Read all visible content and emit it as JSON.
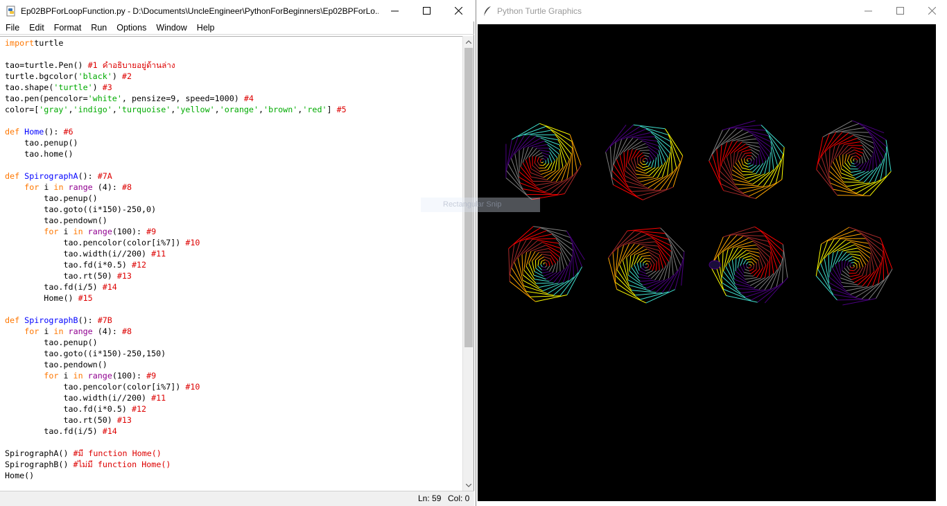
{
  "idle": {
    "title": "Ep02BPForLoopFunction.py - D:\\Documents\\UncleEngineer\\PythonForBeginners\\Ep02BPForLo...",
    "menu": [
      "File",
      "Edit",
      "Format",
      "Run",
      "Options",
      "Window",
      "Help"
    ],
    "code_lines": [
      [
        [
          "kw",
          "import"
        ],
        [
          "",
          "turtle"
        ]
      ],
      [],
      [
        [
          "",
          "tao=turtle.Pen() "
        ],
        [
          "cm",
          "#1 คำอธิบายอยู่ด้านล่าง"
        ]
      ],
      [
        [
          "",
          "turtle.bgcolor("
        ],
        [
          "str",
          "'black'"
        ],
        [
          "",
          ") "
        ],
        [
          "cm",
          "#2"
        ]
      ],
      [
        [
          "",
          "tao.shape("
        ],
        [
          "str",
          "'turtle'"
        ],
        [
          "",
          ") "
        ],
        [
          "cm",
          "#3"
        ]
      ],
      [
        [
          "",
          "tao.pen(pencolor="
        ],
        [
          "str",
          "'white'"
        ],
        [
          "",
          ", pensize=9, speed=1000) "
        ],
        [
          "cm",
          "#4"
        ]
      ],
      [
        [
          "",
          "color=["
        ],
        [
          "str",
          "'gray'"
        ],
        [
          "",
          ","
        ],
        [
          "str",
          "'indigo'"
        ],
        [
          "",
          ","
        ],
        [
          "str",
          "'turquoise'"
        ],
        [
          "",
          ","
        ],
        [
          "str",
          "'yellow'"
        ],
        [
          "",
          ","
        ],
        [
          "str",
          "'orange'"
        ],
        [
          "",
          ","
        ],
        [
          "str",
          "'brown'"
        ],
        [
          "",
          ","
        ],
        [
          "str",
          "'red'"
        ],
        [
          "",
          "] "
        ],
        [
          "cm",
          "#5"
        ]
      ],
      [],
      [
        [
          "kw",
          "def"
        ],
        [
          "",
          " "
        ],
        [
          "df",
          "Home"
        ],
        [
          "",
          "(): "
        ],
        [
          "cm",
          "#6"
        ]
      ],
      [
        [
          "",
          "    tao.penup()"
        ]
      ],
      [
        [
          "",
          "    tao.home()"
        ]
      ],
      [],
      [
        [
          "kw",
          "def"
        ],
        [
          "",
          " "
        ],
        [
          "df",
          "SpirographA"
        ],
        [
          "",
          "(): "
        ],
        [
          "cm",
          "#7A"
        ]
      ],
      [
        [
          "",
          "    "
        ],
        [
          "kw",
          "for"
        ],
        [
          "",
          " i "
        ],
        [
          "kw",
          "in"
        ],
        [
          "",
          " "
        ],
        [
          "bi",
          "range"
        ],
        [
          "",
          " (4): "
        ],
        [
          "cm",
          "#8"
        ]
      ],
      [
        [
          "",
          "        tao.penup()"
        ]
      ],
      [
        [
          "",
          "        tao.goto((i*150)-250,0)"
        ]
      ],
      [
        [
          "",
          "        tao.pendown()"
        ]
      ],
      [
        [
          "",
          "        "
        ],
        [
          "kw",
          "for"
        ],
        [
          "",
          " i "
        ],
        [
          "kw",
          "in"
        ],
        [
          "",
          " "
        ],
        [
          "bi",
          "range"
        ],
        [
          "",
          "(100): "
        ],
        [
          "cm",
          "#9"
        ]
      ],
      [
        [
          "",
          "            tao.pencolor(color[i%7]) "
        ],
        [
          "cm",
          "#10"
        ]
      ],
      [
        [
          "",
          "            tao.width(i//200) "
        ],
        [
          "cm",
          "#11"
        ]
      ],
      [
        [
          "",
          "            tao.fd(i*0.5) "
        ],
        [
          "cm",
          "#12"
        ]
      ],
      [
        [
          "",
          "            tao.rt(50) "
        ],
        [
          "cm",
          "#13"
        ]
      ],
      [
        [
          "",
          "        tao.fd(i/5) "
        ],
        [
          "cm",
          "#14"
        ]
      ],
      [
        [
          "",
          "        Home() "
        ],
        [
          "cm",
          "#15"
        ]
      ],
      [],
      [
        [
          "kw",
          "def"
        ],
        [
          "",
          " "
        ],
        [
          "df",
          "SpirographB"
        ],
        [
          "",
          "(): "
        ],
        [
          "cm",
          "#7B"
        ]
      ],
      [
        [
          "",
          "    "
        ],
        [
          "kw",
          "for"
        ],
        [
          "",
          " i "
        ],
        [
          "kw",
          "in"
        ],
        [
          "",
          " "
        ],
        [
          "bi",
          "range"
        ],
        [
          "",
          " (4): "
        ],
        [
          "cm",
          "#8"
        ]
      ],
      [
        [
          "",
          "        tao.penup()"
        ]
      ],
      [
        [
          "",
          "        tao.goto((i*150)-250,150)"
        ]
      ],
      [
        [
          "",
          "        tao.pendown()"
        ]
      ],
      [
        [
          "",
          "        "
        ],
        [
          "kw",
          "for"
        ],
        [
          "",
          " i "
        ],
        [
          "kw",
          "in"
        ],
        [
          "",
          " "
        ],
        [
          "bi",
          "range"
        ],
        [
          "",
          "(100): "
        ],
        [
          "cm",
          "#9"
        ]
      ],
      [
        [
          "",
          "            tao.pencolor(color[i%7]) "
        ],
        [
          "cm",
          "#10"
        ]
      ],
      [
        [
          "",
          "            tao.width(i//200) "
        ],
        [
          "cm",
          "#11"
        ]
      ],
      [
        [
          "",
          "            tao.fd(i*0.5) "
        ],
        [
          "cm",
          "#12"
        ]
      ],
      [
        [
          "",
          "            tao.rt(50) "
        ],
        [
          "cm",
          "#13"
        ]
      ],
      [
        [
          "",
          "        tao.fd(i/5) "
        ],
        [
          "cm",
          "#14"
        ]
      ],
      [],
      [
        [
          "",
          "SpirographA() "
        ],
        [
          "cm",
          "#มี function Home()"
        ]
      ],
      [
        [
          "",
          "SpirographB() "
        ],
        [
          "cm",
          "#ไม่มี function Home()"
        ]
      ],
      [
        [
          "",
          "Home()"
        ]
      ]
    ],
    "status": {
      "ln": "Ln: 59",
      "col": "Col: 0"
    }
  },
  "turtle": {
    "title": "Python Turtle Graphics",
    "background": "#000000",
    "spiro_colors": [
      "#808080",
      "#4b0082",
      "#40e0d0",
      "#ffff00",
      "#ffa500",
      "#a52a2a",
      "#ff0000"
    ],
    "spirograph_count": 8
  },
  "overlay": {
    "snip_text": "Rectangular Snip"
  },
  "colors": {
    "keyword": "#ff7700",
    "builtin": "#900090",
    "string": "#00aa00",
    "comment": "#dd0000",
    "definition": "#0000ff"
  }
}
